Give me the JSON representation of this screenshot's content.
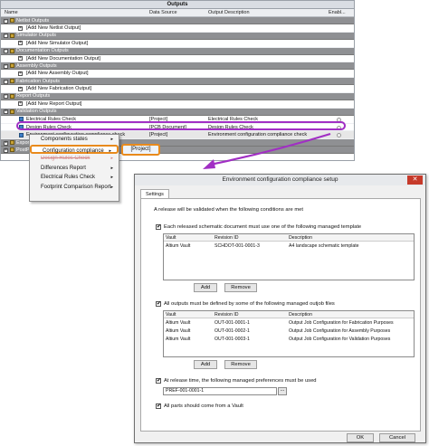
{
  "outputs": {
    "title": "Outputs",
    "columns": [
      "Name",
      "Data Source",
      "Output Description",
      "Enabl..."
    ],
    "rows": [
      {
        "kind": "group",
        "label": "Netlist Outputs"
      },
      {
        "kind": "item",
        "label": "[Add New Netlist Output]"
      },
      {
        "kind": "group",
        "label": "Simulator Outputs"
      },
      {
        "kind": "item",
        "label": "[Add New Simulator Output]"
      },
      {
        "kind": "group",
        "label": "Documentation Outputs"
      },
      {
        "kind": "item",
        "label": "[Add New Documentation Output]"
      },
      {
        "kind": "group",
        "label": "Assembly Outputs"
      },
      {
        "kind": "item",
        "label": "[Add New Assembly Output]"
      },
      {
        "kind": "group",
        "label": "Fabrication Outputs"
      },
      {
        "kind": "item",
        "label": "[Add New Fabrication Output]"
      },
      {
        "kind": "group",
        "label": "Report Outputs"
      },
      {
        "kind": "item",
        "label": "[Add New Report Output]"
      },
      {
        "kind": "group",
        "label": "Validation Outputs"
      },
      {
        "kind": "item",
        "label": "Electrical Rules Check",
        "source": "[Project]",
        "desc": "Electrical Rules Check"
      },
      {
        "kind": "item",
        "label": "Design Rules Check",
        "source": "[PCB Document]",
        "desc": "Design Rules Check"
      },
      {
        "kind": "item",
        "label": "Environment configuration compliance check",
        "source": "[Project]",
        "desc": "Environment configuration compliance check"
      },
      {
        "kind": "group",
        "label": "Export Outputs"
      },
      {
        "kind": "group",
        "label": "PostProcess Outputs"
      }
    ]
  },
  "context_menu": {
    "items": [
      {
        "label": "Components states",
        "arrow": "▸"
      },
      {
        "label": "Configuration compliance",
        "arrow": "▸"
      },
      {
        "label": "Design Rules Check",
        "arrow": "▸"
      },
      {
        "label": "Differences Report",
        "arrow": "▸"
      },
      {
        "label": "Electrical Rules Check",
        "arrow": "▸"
      },
      {
        "label": "Footprint Comparison Report",
        "arrow": "▸"
      }
    ],
    "submenu_item": "[Project]"
  },
  "dialog": {
    "title": "Environment configuration compliance setup",
    "tab": "Settings",
    "intro": "A release will be validated when the following conditions are met",
    "section1": {
      "label": "Each released schematic document must use one of the following managed template",
      "checked": "✔",
      "columns": [
        "Vault",
        "Revision ID",
        "Description"
      ],
      "rows": [
        {
          "vault": "Altium Vault",
          "rev": "SCHDOT-001-0001-3",
          "desc": "A4 landscape schematic template"
        }
      ]
    },
    "section2": {
      "label": "All outputs must be defined by some of the following managed outjob files",
      "checked": "✔",
      "columns": [
        "Vault",
        "Revision ID",
        "Description"
      ],
      "rows": [
        {
          "vault": "Altium Vault",
          "rev": "OUT-001-0001-1",
          "desc": "Output Job Configuration for Fabrication Purposes"
        },
        {
          "vault": "Altium Vault",
          "rev": "OUT-001-0002-1",
          "desc": "Output Job Configuration for Assembly Purposes"
        },
        {
          "vault": "Altium Vault",
          "rev": "OUT-001-0003-1",
          "desc": "Output Job Configuration for Validation Purposes"
        }
      ]
    },
    "section3": {
      "label": "At release time, the following managed preferences must be used",
      "checked": "✔",
      "value": "PREF-001-0001-1",
      "browse": "..."
    },
    "section4": {
      "label": "All parts should  come from a Vault",
      "checked": "✔"
    },
    "add_label": "Add",
    "remove_label": "Remove",
    "ok_label": "OK",
    "cancel_label": "Cancel"
  }
}
